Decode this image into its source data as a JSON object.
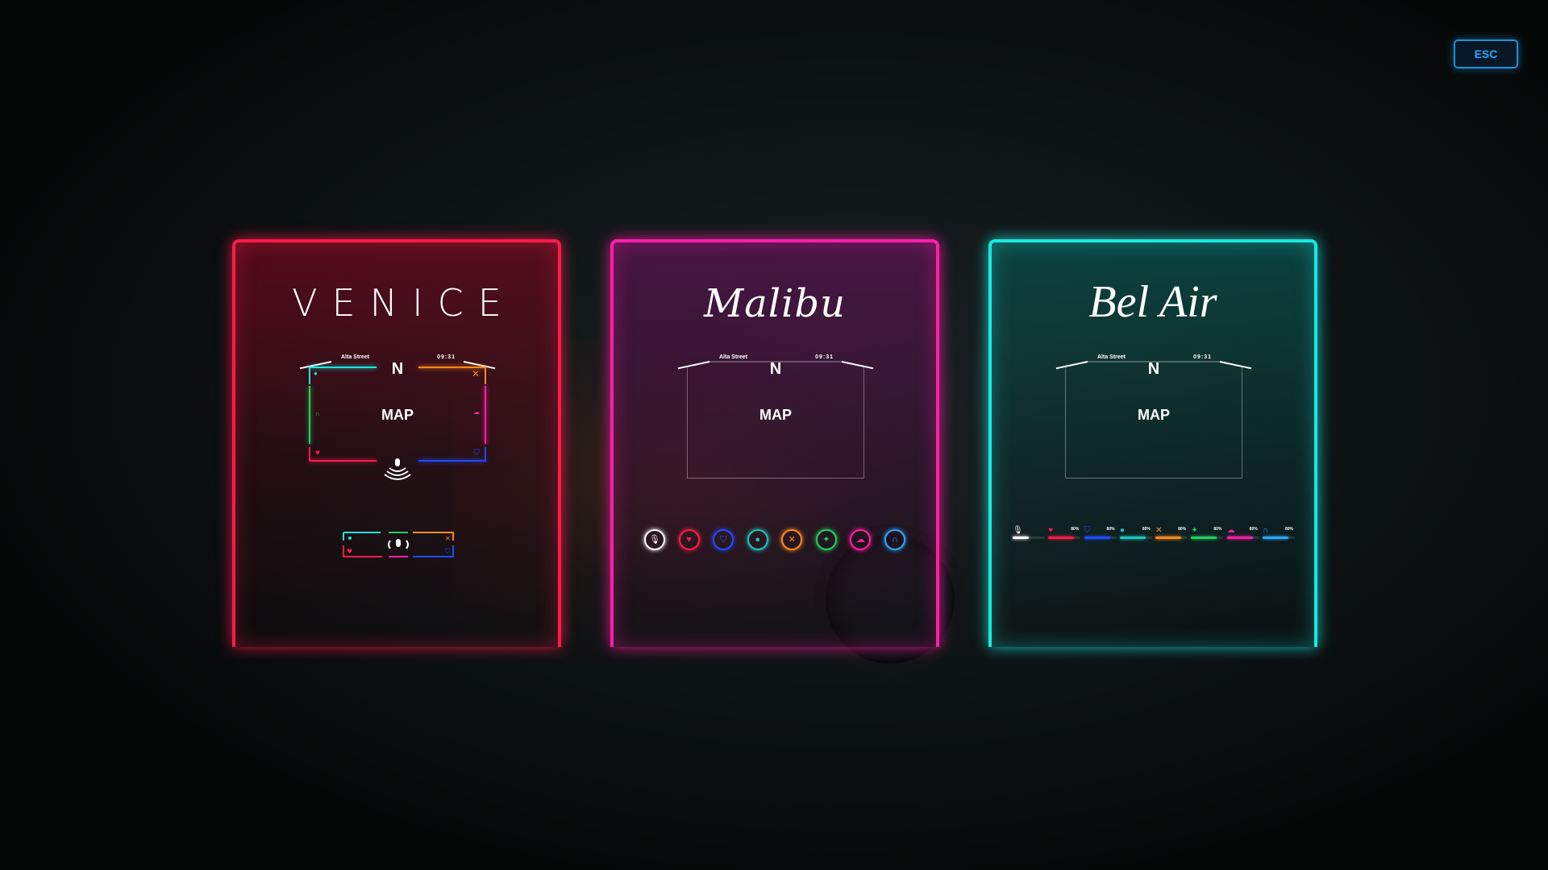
{
  "esc_label": "ESC",
  "minimap": {
    "street": "Alta Street",
    "time": "09:31",
    "north": "N",
    "map_label": "MAP"
  },
  "cards": {
    "venice": {
      "title": "VENICE",
      "accent": "#ff1a4a"
    },
    "malibu": {
      "title": "Malibu",
      "accent": "#ff1fa8"
    },
    "belair": {
      "title": "Bel Air",
      "accent": "#18e8e0"
    }
  },
  "malibu_icons": [
    {
      "icon": "microphone-icon",
      "glyph": "🎙",
      "color": "#ffffff"
    },
    {
      "icon": "heart-icon",
      "glyph": "♥",
      "color": "#ff1a4a"
    },
    {
      "icon": "armor-icon",
      "glyph": "⛉",
      "color": "#1f4dff"
    },
    {
      "icon": "water-drop-icon",
      "glyph": "●",
      "color": "#18c8c0"
    },
    {
      "icon": "hunger-icon",
      "glyph": "✕",
      "color": "#ff8a1a"
    },
    {
      "icon": "stamina-icon",
      "glyph": "✦",
      "color": "#22d060"
    },
    {
      "icon": "stress-icon",
      "glyph": "☁",
      "color": "#ff1fa8"
    },
    {
      "icon": "lungs-icon",
      "glyph": "∩",
      "color": "#2aa8ff"
    }
  ],
  "belair_stats": [
    {
      "icon": "microphone-icon",
      "glyph": "🎙",
      "color": "#ffffff",
      "pct": "",
      "level": 0.5
    },
    {
      "icon": "heart-icon",
      "glyph": "♥",
      "color": "#ff1a4a",
      "pct": "80%",
      "level": 0.8
    },
    {
      "icon": "armor-icon",
      "glyph": "⛉",
      "color": "#1f4dff",
      "pct": "80%",
      "level": 0.8
    },
    {
      "icon": "water-drop-icon",
      "glyph": "●",
      "color": "#18c8c0",
      "pct": "80%",
      "level": 0.8
    },
    {
      "icon": "hunger-icon",
      "glyph": "✕",
      "color": "#ff8a1a",
      "pct": "80%",
      "level": 0.8
    },
    {
      "icon": "stamina-icon",
      "glyph": "✦",
      "color": "#22d060",
      "pct": "80%",
      "level": 0.8
    },
    {
      "icon": "stress-icon",
      "glyph": "☁",
      "color": "#ff1fa8",
      "pct": "80%",
      "level": 0.8
    },
    {
      "icon": "lungs-icon",
      "glyph": "∩",
      "color": "#2aa8ff",
      "pct": "80%",
      "level": 0.8
    }
  ]
}
